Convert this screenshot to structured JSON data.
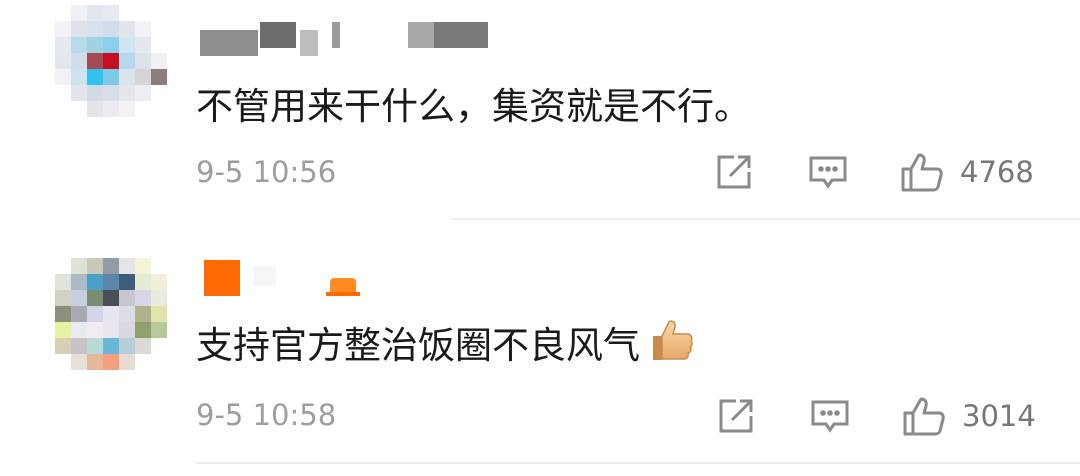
{
  "comments": [
    {
      "text": "不管用来干什么，集资就是不行。",
      "time": "9-5 10:56",
      "likes": "4768",
      "share_icon": "share-icon",
      "reply_icon": "comment-icon",
      "like_icon": "thumbs-up-icon"
    },
    {
      "text": "支持官方整治饭圈不良风气",
      "time": "9-5 10:58",
      "likes": "3014",
      "emoji": "thumbs-up-emoji",
      "share_icon": "share-icon",
      "reply_icon": "comment-icon",
      "like_icon": "thumbs-up-icon",
      "badge_color": "#ff6a00"
    }
  ]
}
